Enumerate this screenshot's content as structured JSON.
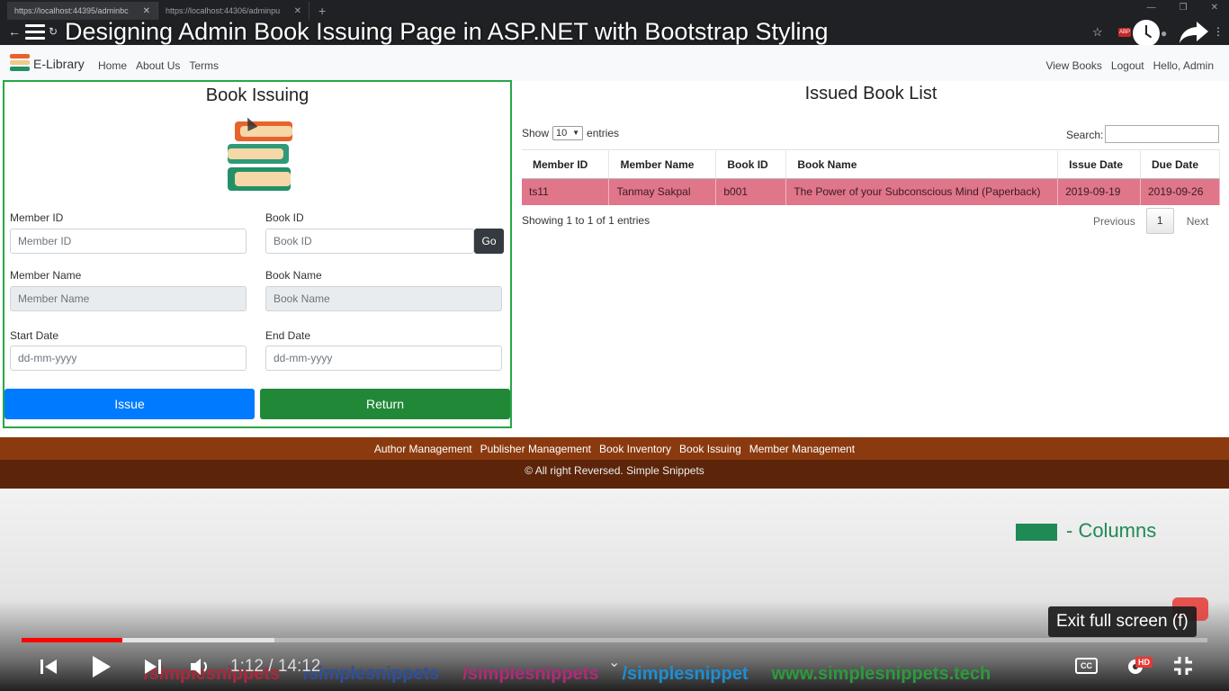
{
  "browser": {
    "tabs": [
      {
        "title": "https://localhost:44395/adminbc"
      },
      {
        "title": "https://localhost:44306/adminpu"
      }
    ],
    "new_tab": "+"
  },
  "video": {
    "title": "Designing Admin Book Issuing Page in ASP.NET with Bootstrap Styling",
    "time": "1:12 / 14:12",
    "progress_fraction": 0.085,
    "buffered_fraction": 0.213,
    "exit_tooltip": "Exit full screen (f)",
    "hd_badge": "HD",
    "overlay_legend_text": "- Columns",
    "socials": [
      "/simplesnippets",
      "/simplesnippets",
      "/simplesnippets",
      "/simplesnippet",
      "www.simplesnippets.tech"
    ]
  },
  "site": {
    "brand": "E-Library",
    "nav_left": [
      "Home",
      "About Us",
      "Terms"
    ],
    "nav_right": [
      "View Books",
      "Logout",
      "Hello, Admin"
    ]
  },
  "form": {
    "title": "Book Issuing",
    "member_id_label": "Member ID",
    "member_id_placeholder": "Member ID",
    "book_id_label": "Book ID",
    "book_id_placeholder": "Book ID",
    "go_label": "Go",
    "member_name_label": "Member Name",
    "member_name_placeholder": "Member Name",
    "book_name_label": "Book Name",
    "book_name_placeholder": "Book Name",
    "start_date_label": "Start Date",
    "start_date_placeholder": "dd-mm-yyyy",
    "end_date_label": "End Date",
    "end_date_placeholder": "dd-mm-yyyy",
    "issue_label": "Issue",
    "return_label": "Return"
  },
  "list": {
    "title": "Issued Book List",
    "show_label": "Show",
    "entries_value": "10",
    "entries_label": "entries",
    "search_label": "Search:",
    "columns": [
      "Member ID",
      "Member Name",
      "Book ID",
      "Book Name",
      "Issue Date",
      "Due Date"
    ],
    "rows": [
      [
        "ts11",
        "Tanmay Sakpal",
        "b001",
        "The Power of your Subconscious Mind (Paperback)",
        "2019-09-19",
        "2019-09-26"
      ]
    ],
    "info": "Showing 1 to 1 of 1 entries",
    "previous": "Previous",
    "page": "1",
    "next": "Next"
  },
  "footer": {
    "links": [
      "Author Management",
      "Publisher Management",
      "Book Inventory",
      "Book Issuing",
      "Member Management"
    ],
    "copyright": "© All right Reversed. Simple Snippets"
  }
}
